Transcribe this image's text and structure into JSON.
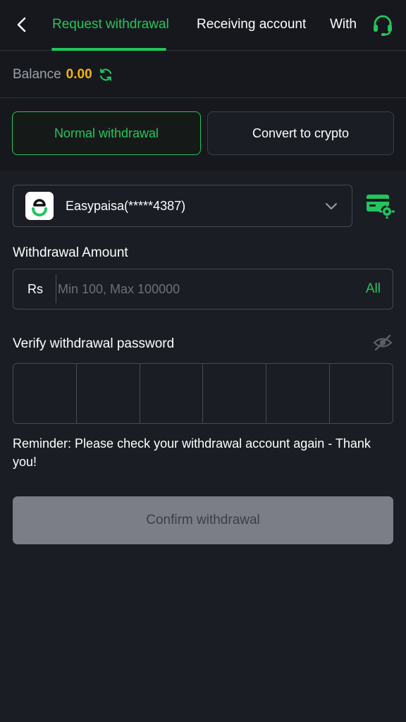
{
  "header": {
    "tabs": [
      {
        "label": "Request withdrawal",
        "active": true
      },
      {
        "label": "Receiving account",
        "active": false
      },
      {
        "label": "With",
        "active": false
      }
    ],
    "back_icon": "chevron-left-icon",
    "support_icon": "headset-icon"
  },
  "balance": {
    "label": "Balance",
    "value": "0.00",
    "refresh_icon": "refresh-icon"
  },
  "modes": {
    "normal": "Normal withdrawal",
    "crypto": "Convert to crypto",
    "selected": "normal"
  },
  "account": {
    "name": "Easypaisa(*****4387)",
    "logo_icon": "easypaisa-logo-icon",
    "settings_icon": "card-settings-icon"
  },
  "amount": {
    "label": "Withdrawal Amount",
    "currency": "Rs",
    "placeholder": "Min 100, Max 100000",
    "value": "",
    "all_label": "All"
  },
  "password": {
    "label": "Verify withdrawal password",
    "cells": 6,
    "eye_icon": "eye-off-icon"
  },
  "reminder": "Reminder: Please check your withdrawal account again - Thank you!",
  "confirm_label": "Confirm withdrawal",
  "colors": {
    "accent": "#22c55e",
    "balance": "#f5b301",
    "background": "#1a1d24",
    "disabled_button": "#7b7e86"
  }
}
